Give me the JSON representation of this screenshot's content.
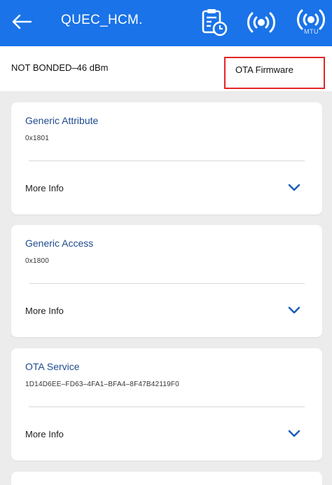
{
  "appbar": {
    "title": "QUEC_HCM.",
    "back_icon": "arrow-left-icon",
    "actions": [
      {
        "icon": "clipboard-clock-icon"
      },
      {
        "icon": "signal-broadcast-icon"
      },
      {
        "icon": "mtu-broadcast-icon",
        "label": "MTU"
      }
    ],
    "color": "#1a73e8"
  },
  "status": {
    "text": "NOT BONDED–46 dBm",
    "ota_label": "OTA Firmware",
    "highlight_color": "#e32626"
  },
  "services": [
    {
      "name": "Generic Attribute",
      "uuid": "0x1801",
      "more": "More Info"
    },
    {
      "name": "Generic Access",
      "uuid": "0x1800",
      "more": "More Info"
    },
    {
      "name": "OTA Service",
      "uuid": "1D14D6EE–FD63–4FA1–BFA4–8F47B42119F0",
      "more": "More Info"
    }
  ]
}
